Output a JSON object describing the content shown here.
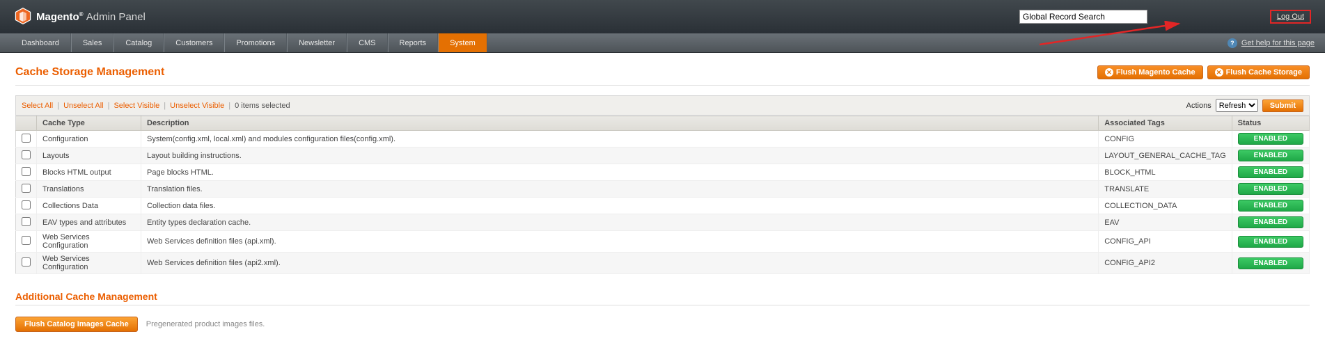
{
  "header": {
    "brand": "Magento",
    "panel": "Admin Panel",
    "search_placeholder": "Global Record Search",
    "logout": "Log Out"
  },
  "nav": {
    "items": [
      "Dashboard",
      "Sales",
      "Catalog",
      "Customers",
      "Promotions",
      "Newsletter",
      "CMS",
      "Reports",
      "System"
    ],
    "active_index": 8,
    "help": "Get help for this page"
  },
  "page": {
    "title": "Cache Storage Management",
    "flush_magento": "Flush Magento Cache",
    "flush_storage": "Flush Cache Storage"
  },
  "massaction": {
    "select_all": "Select All",
    "unselect_all": "Unselect All",
    "select_visible": "Select Visible",
    "unselect_visible": "Unselect Visible",
    "items_selected": "0 items selected",
    "actions_label": "Actions",
    "action_selected": "Refresh",
    "submit": "Submit"
  },
  "table": {
    "headers": {
      "cache_type": "Cache Type",
      "description": "Description",
      "tags": "Associated Tags",
      "status": "Status"
    },
    "rows": [
      {
        "type": "Configuration",
        "desc": "System(config.xml, local.xml) and modules configuration files(config.xml).",
        "tags": "CONFIG",
        "status": "ENABLED"
      },
      {
        "type": "Layouts",
        "desc": "Layout building instructions.",
        "tags": "LAYOUT_GENERAL_CACHE_TAG",
        "status": "ENABLED"
      },
      {
        "type": "Blocks HTML output",
        "desc": "Page blocks HTML.",
        "tags": "BLOCK_HTML",
        "status": "ENABLED"
      },
      {
        "type": "Translations",
        "desc": "Translation files.",
        "tags": "TRANSLATE",
        "status": "ENABLED"
      },
      {
        "type": "Collections Data",
        "desc": "Collection data files.",
        "tags": "COLLECTION_DATA",
        "status": "ENABLED"
      },
      {
        "type": "EAV types and attributes",
        "desc": "Entity types declaration cache.",
        "tags": "EAV",
        "status": "ENABLED"
      },
      {
        "type": "Web Services Configuration",
        "desc": "Web Services definition files (api.xml).",
        "tags": "CONFIG_API",
        "status": "ENABLED"
      },
      {
        "type": "Web Services Configuration",
        "desc": "Web Services definition files (api2.xml).",
        "tags": "CONFIG_API2",
        "status": "ENABLED"
      }
    ]
  },
  "additional": {
    "title": "Additional Cache Management",
    "flush_catalog": "Flush Catalog Images Cache",
    "flush_catalog_desc": "Pregenerated product images files."
  }
}
